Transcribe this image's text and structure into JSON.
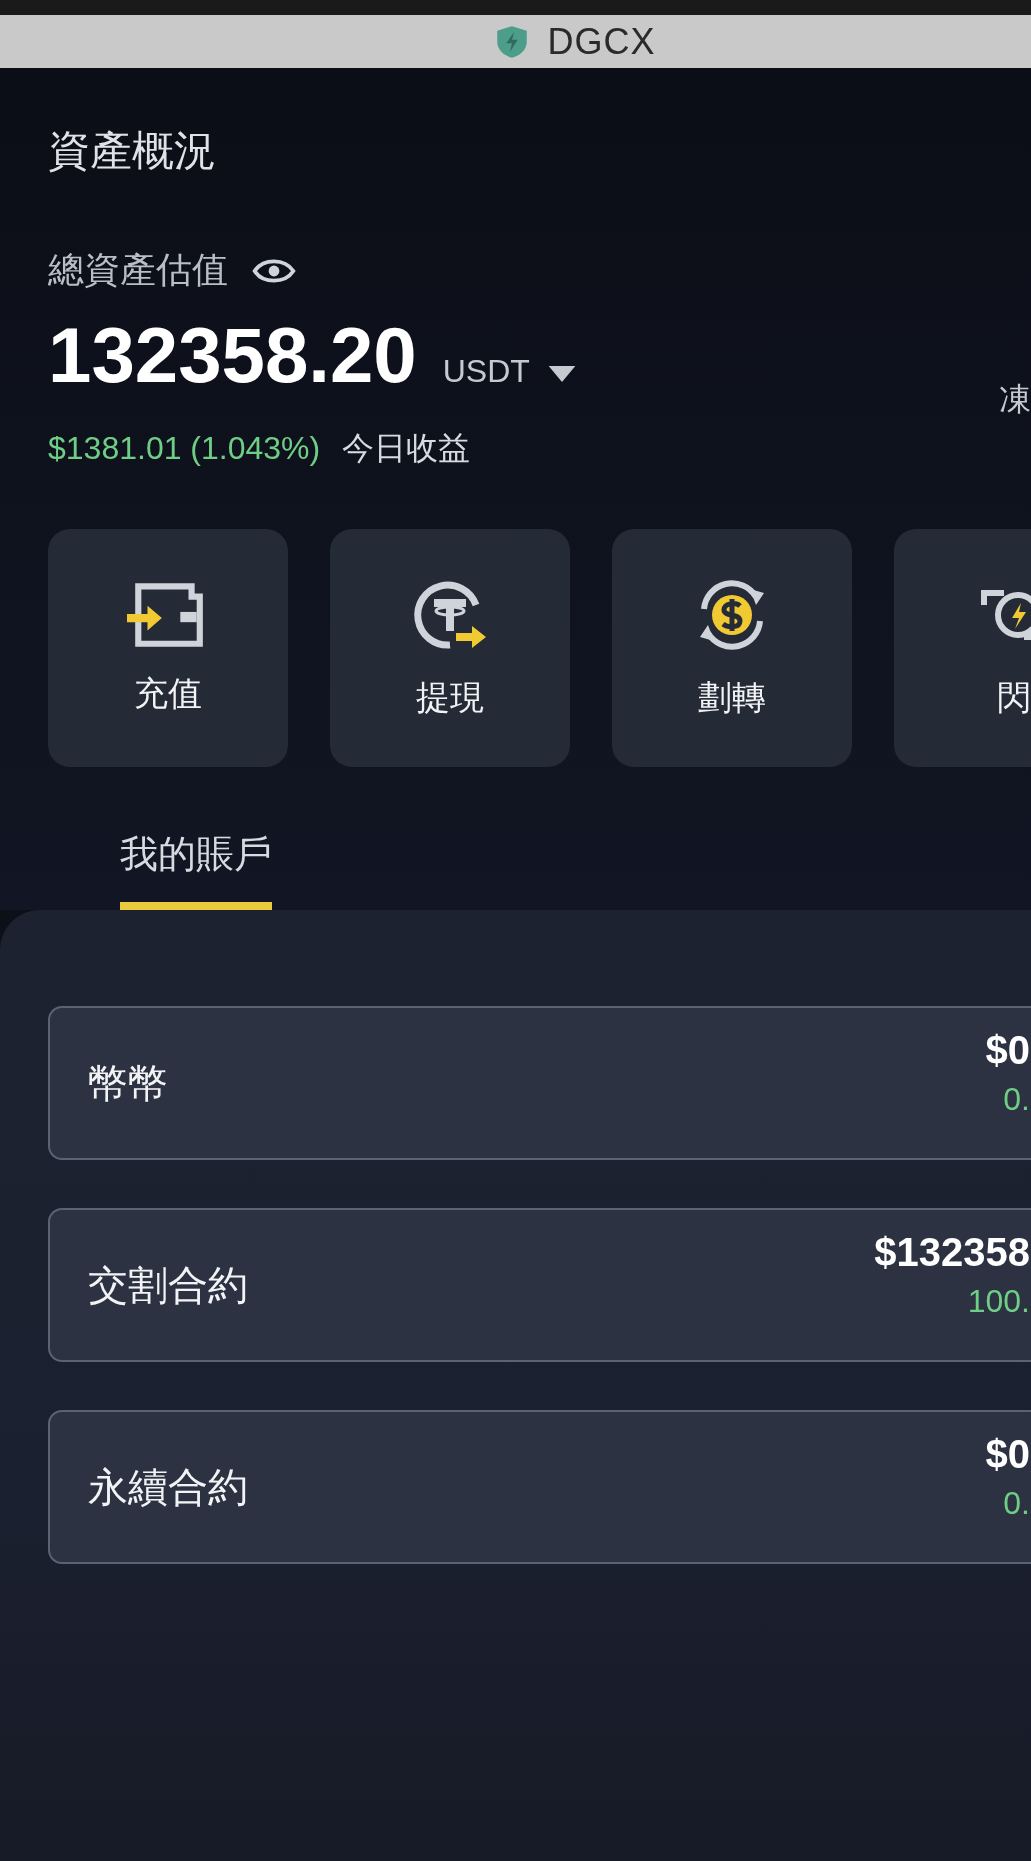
{
  "top_bar": {
    "title": "DGCX"
  },
  "header": {
    "title": "資產概況"
  },
  "balance": {
    "label": "總資產估值",
    "amount": "132358.20",
    "currency": "USDT",
    "side_label": "凍",
    "pnl": "$1381.01 (1.043%)",
    "pnl_label": "今日收益"
  },
  "actions": [
    {
      "kind": "deposit",
      "label": "充值"
    },
    {
      "kind": "withdraw",
      "label": "提現"
    },
    {
      "kind": "transfer",
      "label": "劃轉"
    },
    {
      "kind": "convert",
      "label": "閃"
    }
  ],
  "tabs": [
    {
      "label": "我的賬戶",
      "selected": true
    }
  ],
  "accounts": [
    {
      "name": "幣幣",
      "value": "$0",
      "share": "0."
    },
    {
      "name": "交割合約",
      "value": "$132358",
      "share": "100."
    },
    {
      "name": "永續合約",
      "value": "$0",
      "share": "0."
    }
  ]
}
